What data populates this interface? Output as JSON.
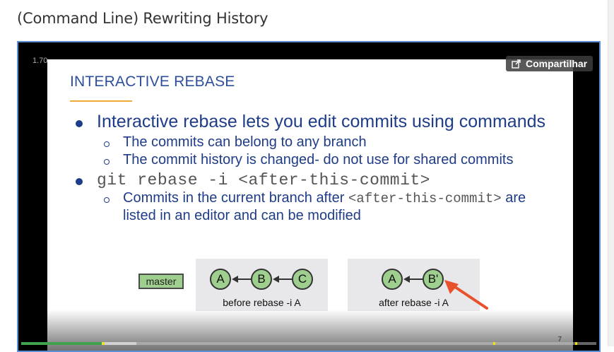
{
  "page": {
    "title": "(Command Line) Rewriting History"
  },
  "player": {
    "speed": "1.70",
    "share_label": "Compartilhar",
    "progress_fraction": 0.14,
    "buffer_fraction": 0.2,
    "accent_color": "#3fa34d"
  },
  "slide": {
    "heading": "INTERACTIVE REBASE",
    "bullet1": "Interactive rebase lets you edit commits using commands",
    "bullet1_sub1": "The commits can belong to any branch",
    "bullet1_sub2": "The commit history is changed- do not use for shared commits",
    "bullet2_cmd": "git rebase -i <after-this-commit>",
    "bullet2_sub_pre": "Commits in the current branch after",
    "bullet2_sub_code": "<after-this-commit>",
    "bullet2_sub_post": "are",
    "bullet2_sub_line2": "listed in an editor and can be modified",
    "slide_number": "7"
  },
  "diagram": {
    "branch_label": "master",
    "before": {
      "nodes": [
        "A",
        "B",
        "C"
      ],
      "caption": "before rebase -i A"
    },
    "after": {
      "nodes": [
        "A",
        "B'"
      ],
      "caption": "after rebase -i A"
    }
  }
}
